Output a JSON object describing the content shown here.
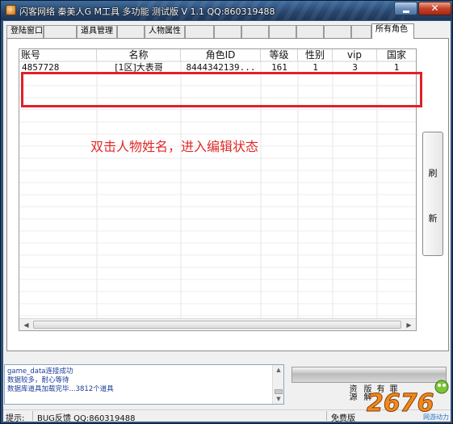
{
  "window": {
    "title": "闪客网络  秦美人G M工具 多功能 测试版 V 1.1  QQ:860319488",
    "close_glyph": "✕"
  },
  "tabs": [
    {
      "label": "登陆窗口",
      "active": false
    },
    {
      "label": "道具管理",
      "active": false
    },
    {
      "label": "人物属性",
      "active": false
    },
    {
      "label": "",
      "active": false
    },
    {
      "label": "",
      "active": false
    },
    {
      "label": "所有角色",
      "active": true
    }
  ],
  "grid": {
    "columns": [
      "账号",
      "名称",
      "角色ID",
      "等级",
      "性别",
      "vip",
      "国家"
    ],
    "rows": [
      [
        "4857728",
        "[1区]大表哥",
        "8444342139...",
        "161",
        "1",
        "3",
        "1"
      ]
    ]
  },
  "hint": "双击人物姓名，进入编辑状态",
  "refresh_button": {
    "chars": [
      "刷",
      "新"
    ]
  },
  "log": {
    "lines": [
      "game_data连接成功",
      "数据较多，耐心等待",
      "数据库道具加载完毕...3812个道具"
    ]
  },
  "vertical_labels": [
    "资源",
    "版解",
    "有",
    "罪"
  ],
  "statusbar": {
    "hint_label": "提示:",
    "feedback": "BUG反馈 QQ:860319488",
    "edition": "免费版"
  },
  "logo": {
    "text": "2676",
    "subtitle": "网游动力"
  },
  "colors": {
    "accent_red": "#e0202a",
    "log_text": "#1c3d9a"
  }
}
